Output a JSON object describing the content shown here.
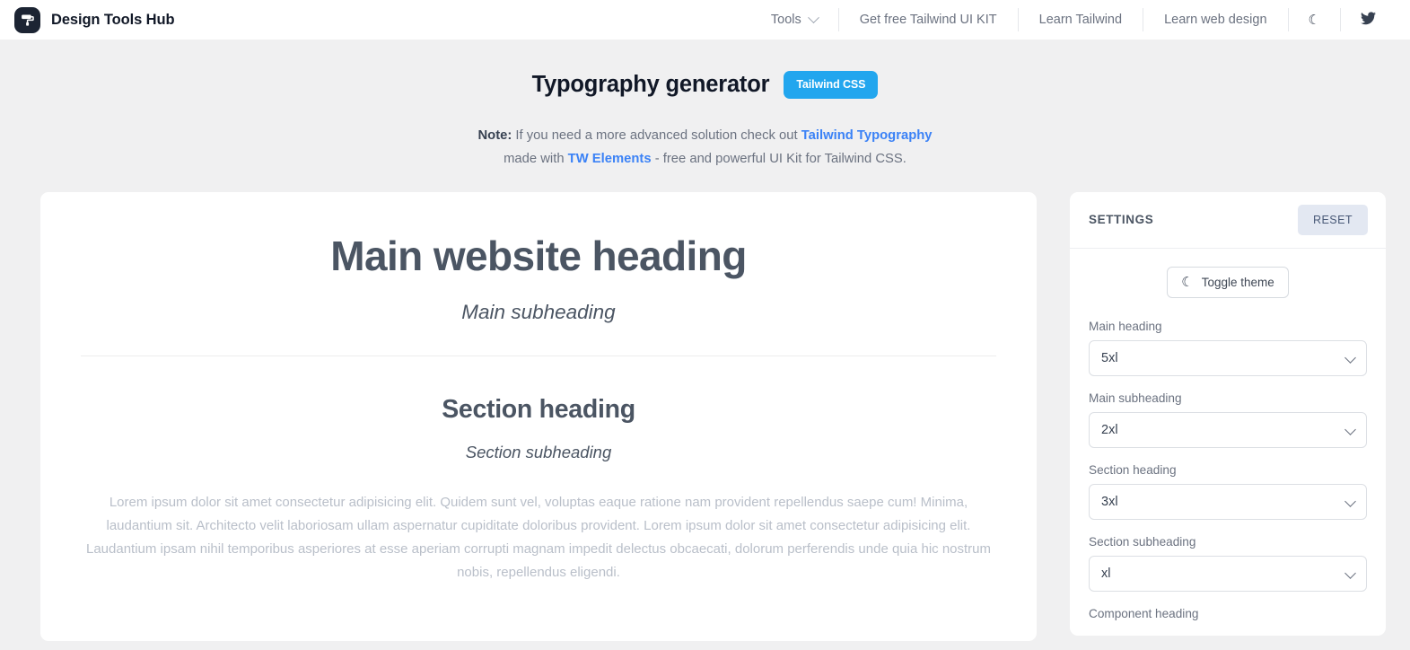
{
  "navbar": {
    "brand": {
      "logo_icon": "paint-roller-icon",
      "title": "Design Tools Hub"
    },
    "items": [
      {
        "label": "Tools",
        "icon": "chevron-down-icon"
      },
      {
        "label": "Get free Tailwind UI KIT"
      },
      {
        "label": "Learn Tailwind"
      },
      {
        "label": "Learn web design"
      }
    ],
    "theme_toggle_icon": "moon-icon",
    "theme_toggle_glyph": "☾",
    "twitter_icon": "twitter-bird-icon"
  },
  "page_head": {
    "title": "Typography generator",
    "badge": "Tailwind CSS",
    "note": {
      "label": "Note:",
      "line1_before": " If you need a more advanced solution check out ",
      "link1": "Tailwind Typography",
      "line2_before": "made with ",
      "link2": "TW Elements",
      "line2_after": " - free and powerful UI Kit for Tailwind CSS."
    }
  },
  "preview": {
    "main_heading": "Main website heading",
    "main_subheading": "Main subheading",
    "section_heading": "Section heading",
    "section_subheading": "Section subheading",
    "body_copy": "Lorem ipsum dolor sit amet consectetur adipisicing elit. Quidem sunt vel, voluptas eaque ratione nam provident repellendus saepe cum! Minima, laudantium sit. Architecto velit laboriosam ullam aspernatur cupiditate doloribus provident. Lorem ipsum dolor sit amet consectetur adipisicing elit. Laudantium ipsam nihil temporibus asperiores at esse aperiam corrupti magnam impedit delectus obcaecati, dolorum perferendis unde quia hic nostrum nobis, repellendus eligendi."
  },
  "settings": {
    "title": "SETTINGS",
    "reset_label": "RESET",
    "theme_toggle": {
      "label": "Toggle theme",
      "icon": "moon-icon",
      "glyph": "☾"
    },
    "fields": [
      {
        "label": "Main heading",
        "value": "5xl"
      },
      {
        "label": "Main subheading",
        "value": "2xl"
      },
      {
        "label": "Section heading",
        "value": "3xl"
      },
      {
        "label": "Section subheading",
        "value": "xl"
      },
      {
        "label": "Component heading",
        "value": ""
      }
    ]
  },
  "colors": {
    "accent_blue": "#22a6ee",
    "link_blue": "#3b82f6",
    "page_bg": "#f0f0f1",
    "card_bg": "#ffffff",
    "reset_bg": "#e3e8f2"
  }
}
